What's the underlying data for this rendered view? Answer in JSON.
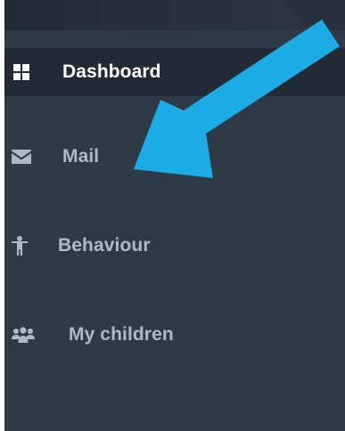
{
  "sidebar": {
    "items": [
      {
        "label": "Dashboard",
        "icon": "dashboard-grid-icon",
        "active": true
      },
      {
        "label": "Mail",
        "icon": "mail-envelope-icon",
        "active": false
      },
      {
        "label": "Behaviour",
        "icon": "person-icon",
        "active": false
      },
      {
        "label": "My children",
        "icon": "users-group-icon",
        "active": false
      }
    ]
  },
  "colors": {
    "sidebar_bg": "#2f3a47",
    "active_bg": "#222b35",
    "active_text": "#ffffff",
    "inactive_text": "#aeb9c6",
    "arrow": "#1bace6"
  },
  "annotation": {
    "type": "arrow",
    "points_to": "Mail"
  }
}
